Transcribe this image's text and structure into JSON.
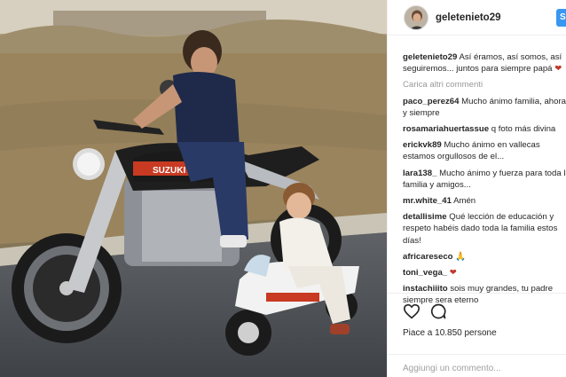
{
  "post": {
    "username": "geletenieto29",
    "follow_label": "S",
    "caption_user": "geletenieto29",
    "caption_text": "Así éramos, así somos, así seguiremos... juntos para siempre papá",
    "load_more": "Carica altri commenti",
    "comments": [
      {
        "user": "paco_perez64",
        "text": "Mucho ánimo familia, ahora y siempre"
      },
      {
        "user": "rosamariahuertassue",
        "text": "q foto más divina"
      },
      {
        "user": "erickvk89",
        "text": "Mucho ánimo en vallecas estamos orgullosos de el..."
      },
      {
        "user": "lara138_",
        "text": "Mucho ánimo y fuerza para toda la familia y amigos..."
      },
      {
        "user": "mr.white_41",
        "text": "Amén"
      },
      {
        "user": "detallisime",
        "text": "Qué lección de educación y respeto habéis dado toda la familia estos días!"
      },
      {
        "user": "africareseco",
        "text": "🙏"
      },
      {
        "user": "toni_vega_",
        "text": "❤"
      },
      {
        "user": "instachiiito",
        "text": "sois muy grandes, tu padre siempre sera eterno"
      }
    ],
    "likes": "Piace a 10.850 persone",
    "add_comment_placeholder": "Aggiungi un commento...",
    "photo_brand": "SUZUKI"
  },
  "colors": {
    "accent": "#3897f0",
    "muted": "#999999"
  },
  "icons": [
    "heart-icon",
    "comment-icon"
  ]
}
